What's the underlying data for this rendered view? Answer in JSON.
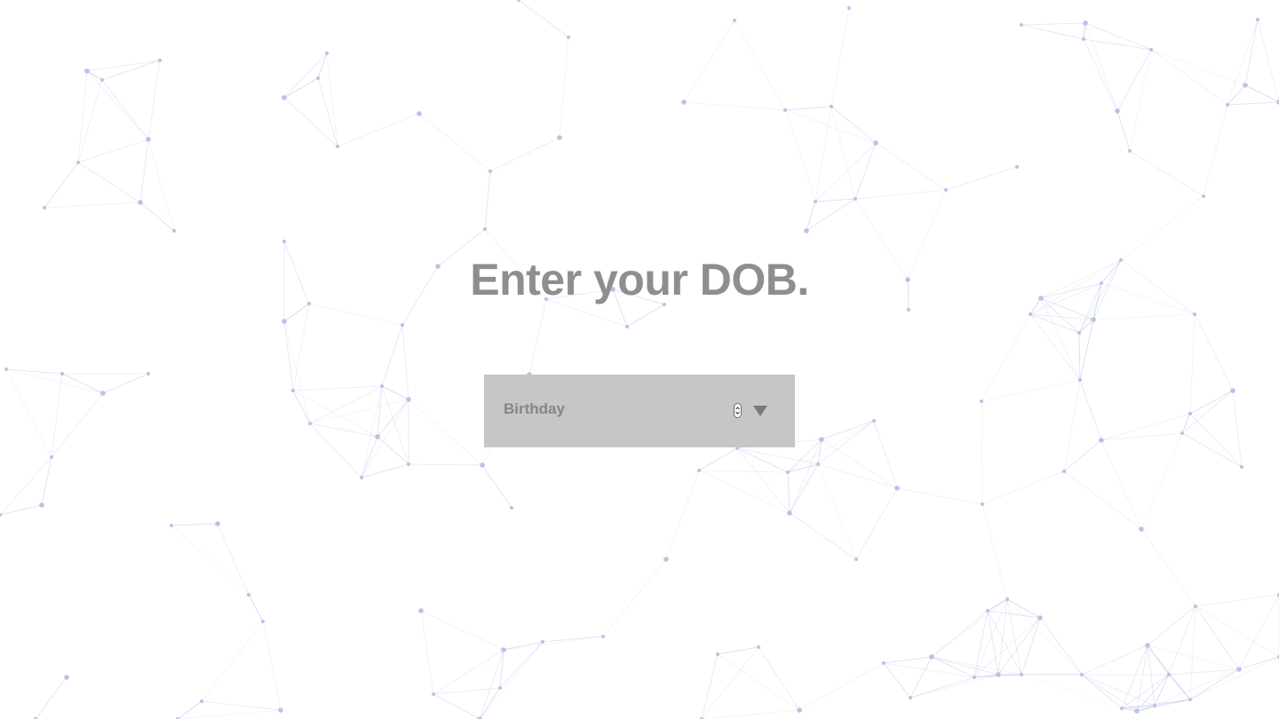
{
  "page": {
    "heading": "Enter your DOB."
  },
  "dob_input": {
    "label": "Birthday"
  },
  "icons": {
    "spinner": "spin-up-down-icon",
    "dropdown": "triangle-down-icon"
  },
  "colors": {
    "background": "#ffffff",
    "heading_text": "#8e8e8e",
    "field_background": "#c6c6c6",
    "field_text": "#868686",
    "network_lines": "#aebbe0",
    "network_nodes": "#b7c3e6"
  }
}
